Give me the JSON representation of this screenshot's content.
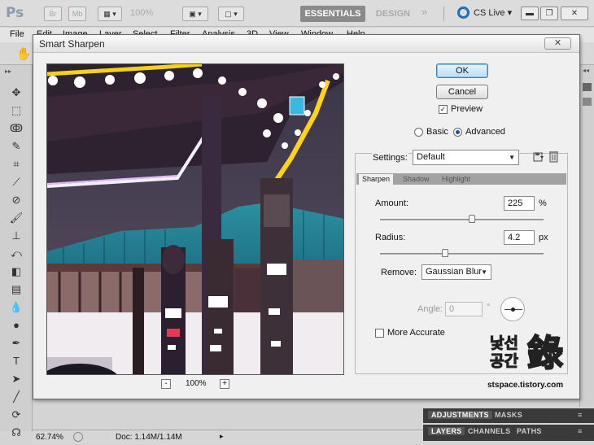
{
  "app": {
    "logo": "Ps",
    "bridge_btn": "Br",
    "minibridge_btn": "Mb",
    "zoom_level": "100%",
    "workspaces": [
      "ESSENTIALS",
      "DESIGN"
    ],
    "more": "»",
    "cslive": "CS Live"
  },
  "menu": [
    "File",
    "Edit",
    "Image",
    "Layer",
    "Select",
    "Filter",
    "Analysis",
    "3D",
    "View",
    "Window",
    "Help"
  ],
  "panels": {
    "tabs_top": [
      "ADJUSTMENTS",
      "MASKS"
    ],
    "tabs_bottom": [
      "LAYERS",
      "CHANNELS",
      "PATHS"
    ]
  },
  "status": {
    "zoom": "62.74%",
    "doc": "Doc: 1.14M/1.14M"
  },
  "dialog": {
    "title": "Smart Sharpen",
    "close": "✕",
    "ok": "OK",
    "cancel": "Cancel",
    "preview_label": "Preview",
    "preview_checked": true,
    "mode_basic": "Basic",
    "mode_advanced": "Advanced",
    "mode_selected": "Advanced",
    "settings_label": "Settings:",
    "settings_value": "Default",
    "tabs": [
      "Sharpen",
      "Shadow",
      "Highlight"
    ],
    "active_tab": "Sharpen",
    "amount_label": "Amount:",
    "amount_value": "225",
    "amount_unit": "%",
    "amount_fraction": 0.56,
    "radius_label": "Radius:",
    "radius_value": "4.2",
    "radius_unit": "px",
    "radius_fraction": 0.4,
    "remove_label": "Remove:",
    "remove_value": "Gaussian Blur",
    "angle_label": "Angle:",
    "angle_value": "0",
    "angle_unit": "°",
    "more_accurate_label": "More Accurate",
    "preview_zoom": "100%",
    "zoom_minus": "-",
    "zoom_plus": "+"
  },
  "watermark": {
    "line1": "낯선",
    "line2": "공간",
    "hanja": "錄",
    "url": "stspace.tistory.com"
  }
}
